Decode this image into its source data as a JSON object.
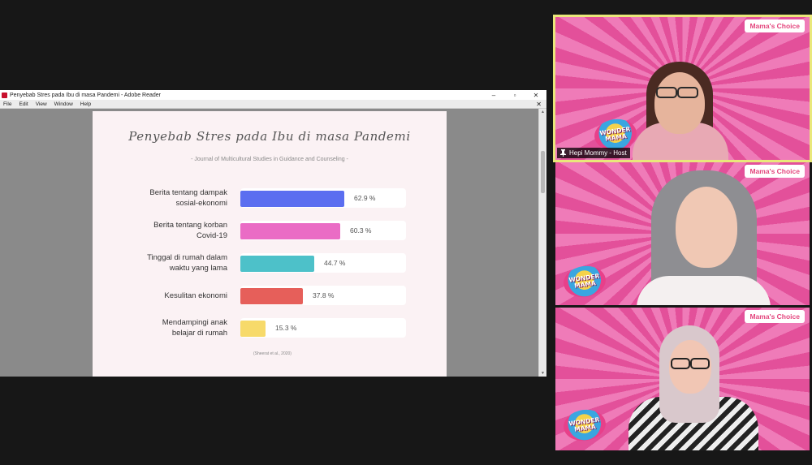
{
  "reader": {
    "window_title": "Penyebab Stres pada Ibu di masa Pandemi - Adobe Reader",
    "menu": [
      "File",
      "Edit",
      "View",
      "Window",
      "Help"
    ],
    "controls": {
      "minimize": "–",
      "maximize": "▫",
      "close": "✕",
      "doc_close": "✕"
    }
  },
  "slide": {
    "title": "Penyebab Stres pada Ibu di masa Pandemi",
    "subtitle": "- Journal of Multicultural Studies in Guidance and Counseling -",
    "source": "(Sheerat et al., 2020)"
  },
  "chart_data": {
    "type": "bar",
    "orientation": "horizontal",
    "title": "Penyebab Stres pada Ibu di masa Pandemi",
    "categories": [
      "Berita tentang dampak\nsosial-ekonomi",
      "Berita tentang korban\nCovid-19",
      "Tinggal di rumah dalam\nwaktu yang lama",
      "Kesulitan ekonomi",
      "Mendampingi anak\nbelajar di rumah"
    ],
    "values": [
      62.9,
      60.3,
      44.7,
      37.8,
      15.3
    ],
    "value_labels": [
      "62.9 %",
      "60.3 %",
      "44.7 %",
      "37.8 %",
      "15.3 %"
    ],
    "colors": [
      "#5b6ef0",
      "#ea6cc5",
      "#4dc1c9",
      "#e65f5a",
      "#f7da6a"
    ],
    "xlim": [
      0,
      100
    ],
    "grid": false
  },
  "tiles": [
    {
      "brand": "Mama's Choice",
      "badge": "WONDER\nMAMA",
      "name": "Hepi Mommy - Host"
    },
    {
      "brand": "Mama's Choice",
      "badge": "WONDER\nMAMA"
    },
    {
      "brand": "Mama's Choice",
      "badge": "WONDER\nMAMA"
    }
  ],
  "colors": {
    "tile_pink": "#ef7bb8",
    "active_border": "#e9e87a",
    "brand_text": "#e4467e"
  }
}
